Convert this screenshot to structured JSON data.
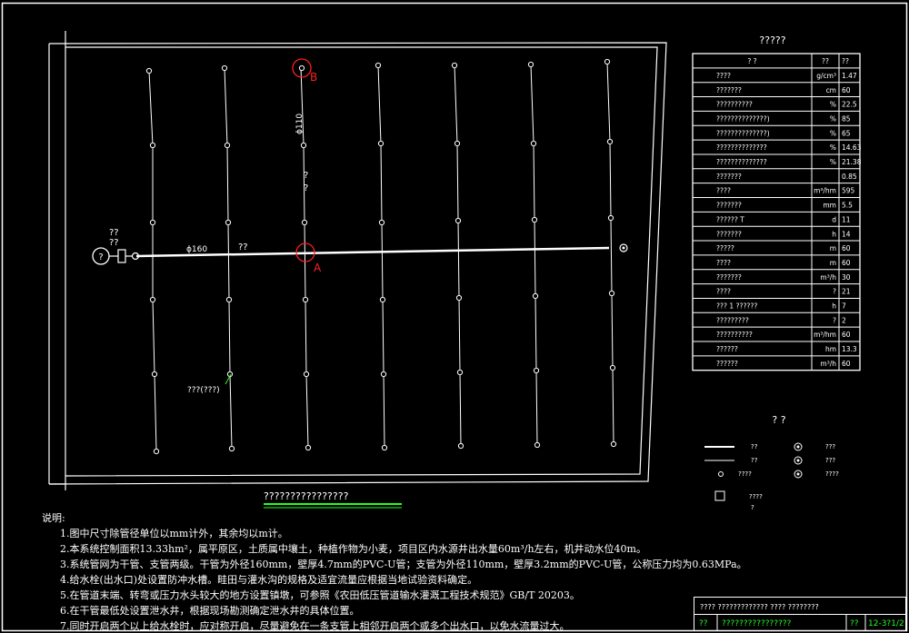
{
  "plan": {
    "pump_label": "?",
    "pump_note_1": "??",
    "pump_note_2": "??",
    "main_pipe_label": "ϕ160",
    "main_pipe_note": "??",
    "branch_pipe_label": "ϕ110",
    "branch_note_1": "?",
    "branch_note_2": "?",
    "point_a": "A",
    "point_b": "B",
    "hydrant_note": "???(???)",
    "caption": "????????????????"
  },
  "param_table": {
    "title": "?????",
    "header": [
      "?    ?",
      "??",
      "??"
    ],
    "rows": [
      [
        "????",
        "g/cm³",
        "1.47"
      ],
      [
        "???????",
        "cm",
        "60"
      ],
      [
        "??????????",
        "%",
        "22.5"
      ],
      [
        "??????????????)",
        "%",
        "85"
      ],
      [
        "??????????????)",
        "%",
        "65"
      ],
      [
        "??????????????",
        "%",
        "14.63"
      ],
      [
        "??????????????",
        "%",
        "21.38"
      ],
      [
        "???????",
        "",
        "0.85"
      ],
      [
        "????",
        "m³/hm",
        "595"
      ],
      [
        "???????",
        "mm",
        "5.5"
      ],
      [
        "??????     T",
        "d",
        "11"
      ],
      [
        "???????",
        "h",
        "14"
      ],
      [
        "?????",
        "m",
        "60"
      ],
      [
        "????",
        "m",
        "60"
      ],
      [
        "???????",
        "m³/h",
        "30"
      ],
      [
        "????",
        "?",
        "21"
      ],
      [
        "???     1 ??????",
        "h",
        "7"
      ],
      [
        "?????????",
        "?",
        "2"
      ],
      [
        "??????????",
        "m³/hm",
        "60"
      ],
      [
        "??????",
        "hm",
        "13.3"
      ],
      [
        "??????",
        "m³/h",
        "60"
      ]
    ]
  },
  "legend": {
    "title": "? ?",
    "items": [
      "??",
      "??",
      "???",
      "???",
      "????",
      "????",
      "???",
      "???"
    ],
    "extra_1": "????",
    "extra_2": "?"
  },
  "notes": {
    "title": "说明:",
    "items": [
      "1.图中尺寸除管径单位以mm计外，其余均以m计。",
      "2.本系统控制面积13.33hm²，属平原区，土质属中壤土，种植作物为小麦，项目区内水源井出水量60m³/h左右，机井动水位40m。",
      "3.系统管网为干管、支管两级。干管为外径160mm，壁厚4.7mm的PVC-U管；支管为外径110mm，壁厚3.2mm的PVC-U管，公称压力均为0.63MPa。",
      "4.给水栓(出水口)处设置防冲水槽。畦田与灌水沟的规格及适宜流量应根据当地试验资料确定。",
      "5.在管道末端、转弯或压力水头较大的地方设置镇墩，可参照《农田低压管道输水灌溉工程技术规范》GB/T 20203。",
      "6.在干管最低处设置泄水井，根据现场勘测确定泄水井的具体位置。",
      "7.同时开启两个以上给水栓时，应对称开启，尽量避免在一条支管上相邻开启两个或多个出水口，以免水流量过大。"
    ]
  },
  "title_block": {
    "row1": "????  ?????????????    ????  ????????",
    "cell_a": "??",
    "cell_b": "????????????????",
    "cell_c": "??",
    "cell_d": "12-3?1/2"
  }
}
